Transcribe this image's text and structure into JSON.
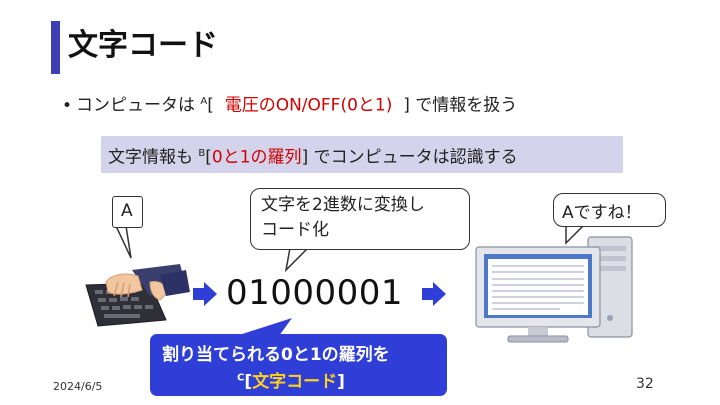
{
  "slide": {
    "title": "文字コード",
    "bullet": {
      "bullet_symbol": "•",
      "prefix": "コンピュータは ",
      "blank_label": "A",
      "open_bracket": "[",
      "answer": "電圧のON/OFF(0と1)",
      "close_bracket": "]",
      "suffix": " で情報を扱う"
    },
    "highlight": {
      "prefix": "文字情報も ",
      "blank_label": "B",
      "open_bracket": "[",
      "answer": "0と1の羅列",
      "close_bracket": "]",
      "suffix": " でコンピュータは認識する"
    },
    "bubbles": {
      "input_letter": "A",
      "convert_line1": "文字を2進数に変換し",
      "convert_line2": "コード化",
      "recognized": "Aですね！"
    },
    "binary_code": "01000001",
    "callout": {
      "line1": "割り当てられる0と1の羅列を",
      "blank_label": "C",
      "open_bracket": "[",
      "answer": "文字コード",
      "close_bracket": "]"
    },
    "footer": {
      "date": "2024/6/5",
      "page_number": "32"
    }
  },
  "colors": {
    "accent_blue": "#3f3fb5",
    "answer_red": "#d40000",
    "highlight_bg": "#d3d3ec",
    "callout_bg": "#2f3ed6",
    "callout_answer": "#ffd21e"
  }
}
